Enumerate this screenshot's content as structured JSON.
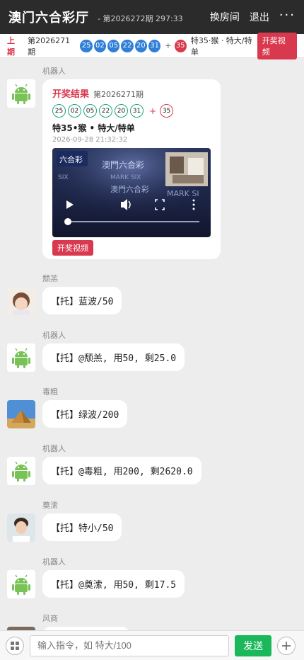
{
  "header": {
    "title": "澳门六合彩厅",
    "issue": "- 第2026272期 297:33",
    "switch_room": "换房间",
    "logout": "退出",
    "more": "···"
  },
  "prev_draw": {
    "label": "上期",
    "period": "第2026271期",
    "numbers": [
      "25",
      "02",
      "05",
      "22",
      "20",
      "31"
    ],
    "special": "35",
    "plus": "+",
    "summary": "特35·猴 · 特大/特单",
    "video_button": "开奖视频"
  },
  "result_card": {
    "sender": "机器人",
    "title": "开奖结果",
    "period": "第2026271期",
    "numbers": [
      "25",
      "02",
      "05",
      "22",
      "20",
      "31"
    ],
    "plus": "+",
    "special": "35",
    "summary": "特35•猴 • 特大/特单",
    "time": "2026-09-28 21:32:32",
    "video_button": "开奖视频",
    "video": {
      "logo_text": "六合彩",
      "banner_text": "澳門六合彩",
      "watermark_1": "MARK SIX",
      "watermark_2": "MARK SI",
      "watermark_3": "SIX"
    }
  },
  "messages": [
    {
      "sender": "颓羔",
      "text": "【托】蓝波/50",
      "avatar": "child-avatar"
    },
    {
      "sender": "机器人",
      "text": "【托】@颓羔, 用50, 剩25.0",
      "avatar": "android-avatar"
    },
    {
      "sender": "毒粗",
      "text": "【托】绿波/200",
      "avatar": "pyramid-avatar"
    },
    {
      "sender": "机器人",
      "text": "【托】@毒粗, 用200, 剩2620.0",
      "avatar": "android-avatar"
    },
    {
      "sender": "奠溹",
      "text": "【托】特小/50",
      "avatar": "boy-avatar"
    },
    {
      "sender": "机器人",
      "text": "【托】@奠溹, 用50, 剩17.5",
      "avatar": "android-avatar"
    },
    {
      "sender": "风商",
      "text": "",
      "avatar": "person-avatar"
    }
  ],
  "input": {
    "placeholder": "输入指令，如 特大/100",
    "send_label": "发送"
  },
  "colors": {
    "header_bg": "#2b2b2b",
    "accent_red": "#d9394e",
    "ball_blue": "#2f7fd8",
    "ball_green_border": "#1aa37a",
    "send_green": "#1bb85b",
    "chat_bg": "#ededed"
  }
}
